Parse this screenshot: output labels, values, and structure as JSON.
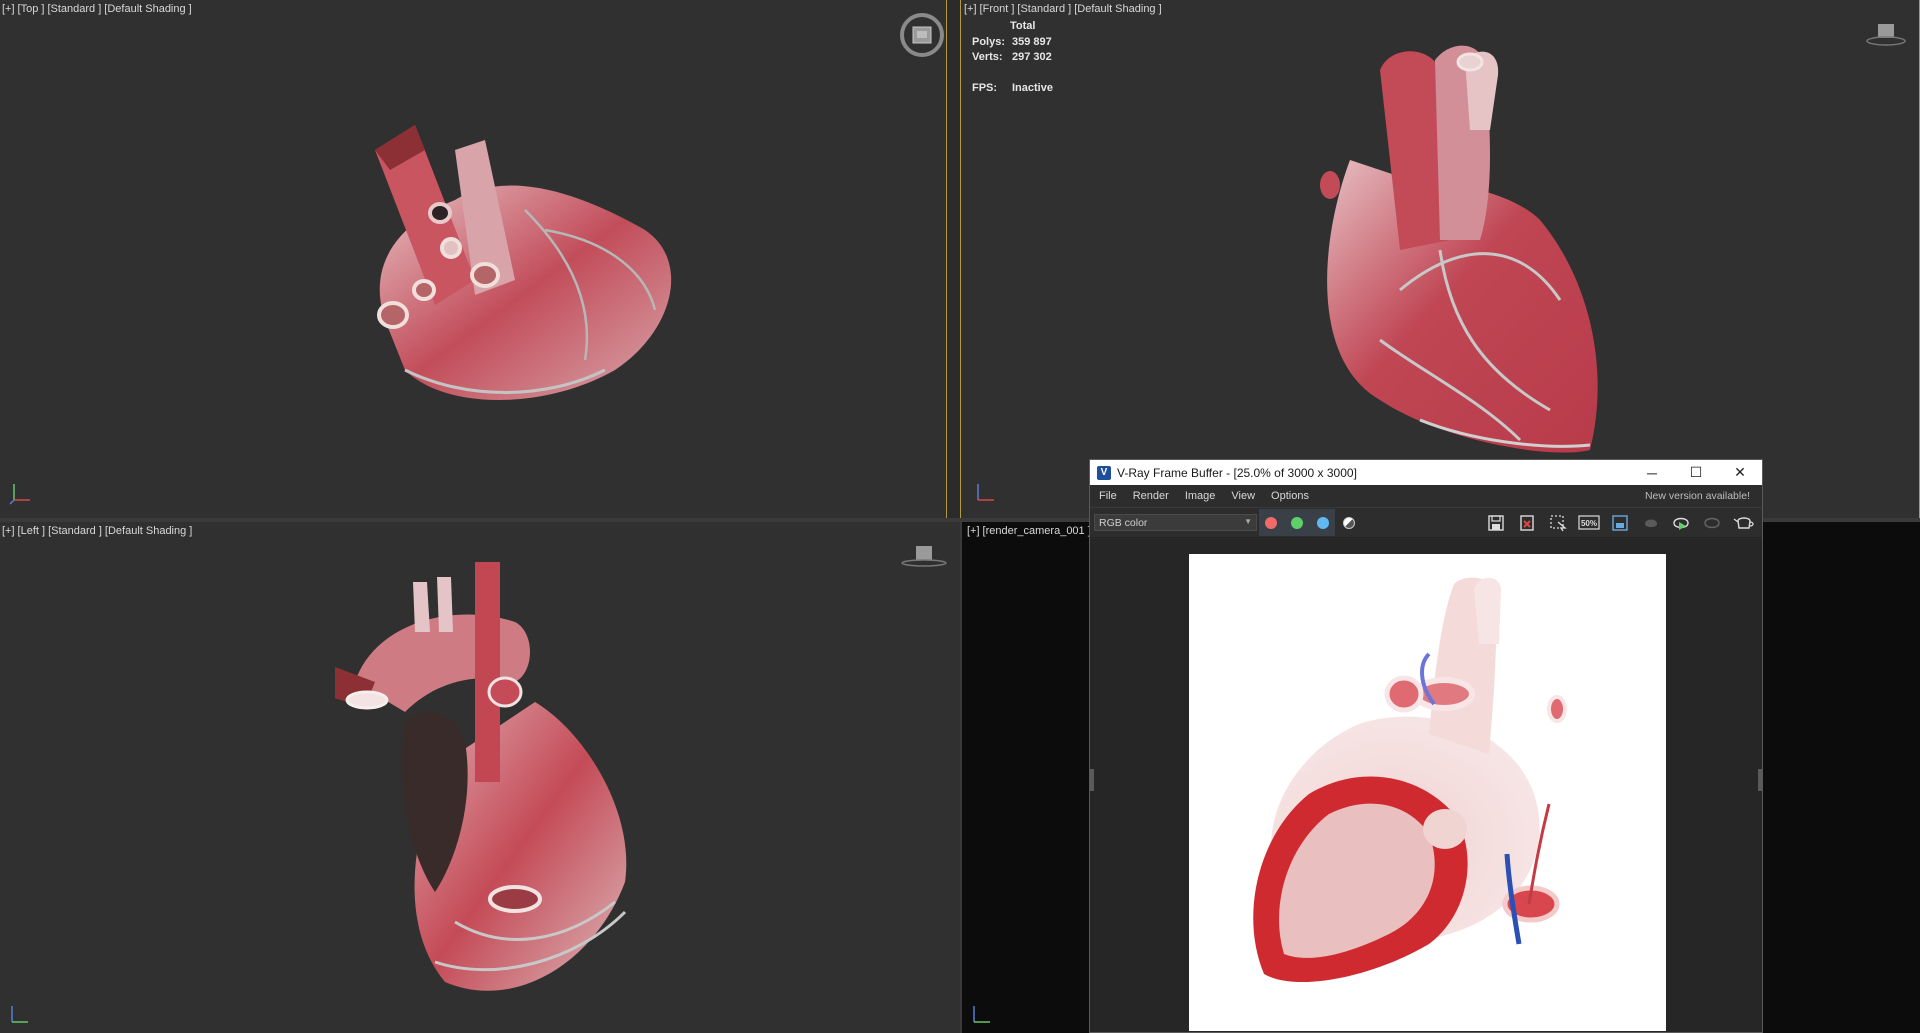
{
  "viewports": {
    "top_left": {
      "labels": [
        "[+]",
        "[Top ]",
        "[Standard ]",
        "[Default Shading ]"
      ]
    },
    "top_right": {
      "labels": [
        "[+]",
        "[Front ]",
        "[Standard ]",
        "[Default Shading ]"
      ],
      "stats": {
        "total_label": "Total",
        "polys_label": "Polys:",
        "polys_value": "359 897",
        "verts_label": "Verts:",
        "verts_value": "297 302",
        "fps_label": "FPS:",
        "fps_value": "Inactive"
      }
    },
    "bottom_left": {
      "labels": [
        "[+]",
        "[Left ]",
        "[Standard ]",
        "[Default Shading ]"
      ]
    },
    "bottom_right": {
      "labels": [
        "[+]",
        "[render_camera_001 ]"
      ]
    }
  },
  "vfb": {
    "title": "V-Ray Frame Buffer - [25.0% of 3000 x 3000]",
    "app_icon": "vray-logo-icon",
    "window_buttons": {
      "minimize": "─",
      "maximize": "☐",
      "close": "✕"
    },
    "menu": [
      "File",
      "Render",
      "Image",
      "View",
      "Options"
    ],
    "new_version": "New version available!",
    "channel_select": "RGB color",
    "channel_dots": [
      "#f06a6a",
      "#5fcf6a",
      "#62b8f0"
    ],
    "tool_icons": [
      "save-icon",
      "clear-icon",
      "region-select-icon",
      "zoom-50-icon",
      "frame-icon",
      "track-mouse-icon",
      "render-icon",
      "render-disabled-icon",
      "teapot-icon"
    ],
    "zoom_label": "50%"
  },
  "colors": {
    "viewport_bg": "#303030",
    "active_border": "#b49a3c",
    "tissue": "#c7505a",
    "render_bg": "#ffffff"
  }
}
